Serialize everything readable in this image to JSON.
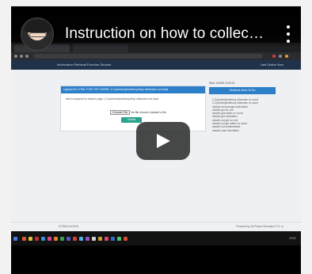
{
  "video": {
    "title": "Instruction on how to collec…",
    "menu_icon": "more-vert-icon",
    "play_icon": "play-icon"
  },
  "site": {
    "header_title": "Information Retrieval Exercise Student",
    "header_right": "Last Online Now",
    "card_title": "Upload the HTML FOR FIST WORD: 2-Cyclohexylmethoxyethyl otherwise not back",
    "card_instruction": "Add to keyword to search page: 2-Cyclohexylmethoxyethyl otherwise not back",
    "file_button": "Choose File",
    "file_name": "No file chosen",
    "file_extra": "Upload/ a file",
    "submit_label": "Submit",
    "side_date": "Start: 1/06/19 10:00:21",
    "side_title": "Students Next To Do",
    "side_items": [
      "2-Cyclohexylmethoxy otherwise no count",
      "2-Cyclohexylmethoxy otherwise no count",
      "classfic aromosugar antioxidant",
      "classfic get de cool",
      "classfic get maker no count",
      "classfic get calculation",
      "classfic out get no cool",
      "classfic out get maker no count",
      "classfic out sustainmaker",
      "classfic case favoritable"
    ],
    "footer_left": "ICTBGS at 2019",
    "footer_right": "Powered by Mt Power Simulator PLC or"
  },
  "taskbar": {
    "tray": "ENG"
  },
  "colors": {
    "card_header": "#2c7fc8",
    "submit": "#2aa28e",
    "site_header": "#20324a"
  }
}
